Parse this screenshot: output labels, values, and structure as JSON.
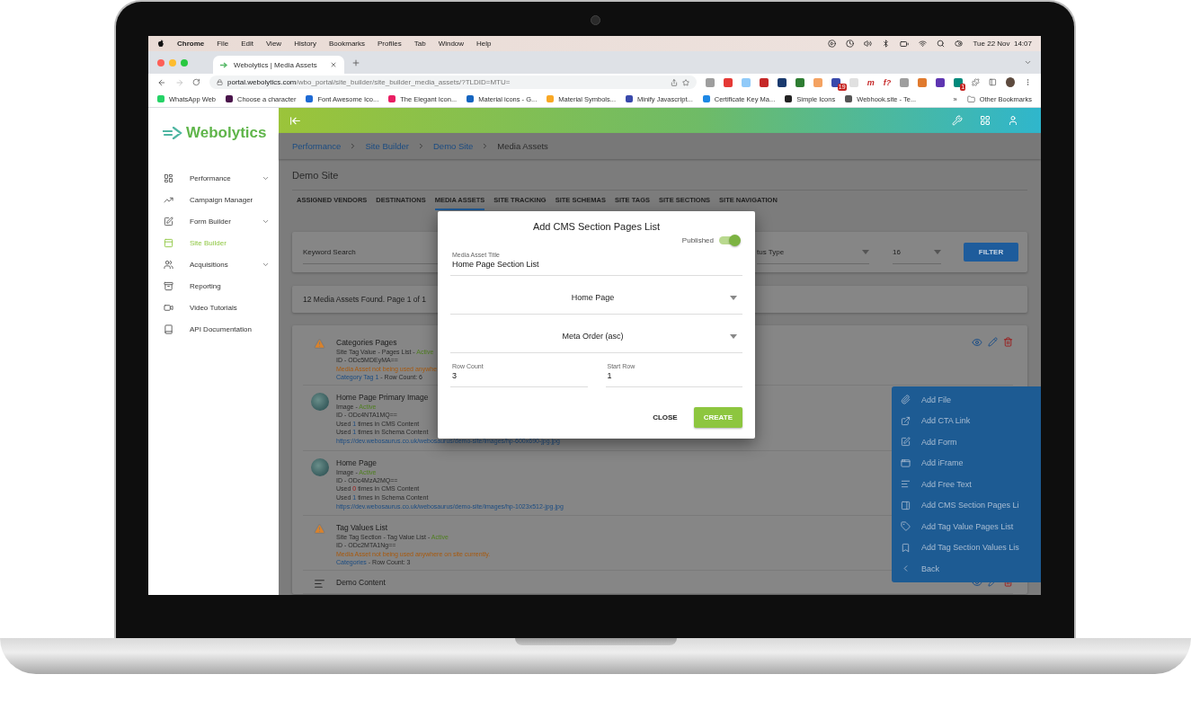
{
  "menubar": {
    "app": "Chrome",
    "menus": [
      "File",
      "Edit",
      "View",
      "History",
      "Bookmarks",
      "Profiles",
      "Tab",
      "Window",
      "Help"
    ],
    "clock": "Tue 22 Nov  14:07"
  },
  "browser": {
    "tab_title": "Webolytics | Media Assets",
    "url_host": "portal.webolytics.com",
    "url_path": "/wbo_portal/site_builder/site_builder_media_assets/?TLDID=MTU=",
    "extension_badges": [
      "19",
      "1"
    ],
    "extension_letters": [
      "m",
      "f?"
    ],
    "bookmarks": [
      "WhatsApp Web",
      "Choose a character",
      "Font Awesome Ico...",
      "The Elegant Icon...",
      "Material icons - G...",
      "Material Symbols...",
      "Minify Javascript...",
      "Certificate Key Ma...",
      "Simple Icons",
      "Webhook.site - Te..."
    ],
    "bookmarks_overflow": "»",
    "other_bookmarks": "Other Bookmarks"
  },
  "sidebar": {
    "brand": "Webolytics",
    "items": [
      {
        "label": "Performance",
        "has_submenu": true,
        "selected": false
      },
      {
        "label": "Campaign Manager",
        "has_submenu": false,
        "selected": false
      },
      {
        "label": "Form Builder",
        "has_submenu": true,
        "selected": false
      },
      {
        "label": "Site Builder",
        "has_submenu": false,
        "selected": true
      },
      {
        "label": "Acquisitions",
        "has_submenu": true,
        "selected": false
      },
      {
        "label": "Reporting",
        "has_submenu": false,
        "selected": false
      },
      {
        "label": "Video Tutorials",
        "has_submenu": false,
        "selected": false
      },
      {
        "label": "API Documentation",
        "has_submenu": false,
        "selected": false
      }
    ]
  },
  "breadcrumb": [
    {
      "label": "Performance",
      "kind": "link"
    },
    {
      "label": "Site Builder",
      "kind": "link"
    },
    {
      "label": "Demo Site",
      "kind": "link"
    },
    {
      "label": "Media Assets",
      "kind": "current"
    }
  ],
  "page_title": "Demo Site",
  "tabs": [
    {
      "label": "ASSIGNED VENDORS",
      "selected": false
    },
    {
      "label": "DESTINATIONS",
      "selected": false
    },
    {
      "label": "MEDIA ASSETS",
      "selected": true
    },
    {
      "label": "SITE TRACKING",
      "selected": false
    },
    {
      "label": "SITE SCHEMAS",
      "selected": false
    },
    {
      "label": "SITE TAGS",
      "selected": false
    },
    {
      "label": "SITE SECTIONS",
      "selected": false
    },
    {
      "label": "SITE NAVIGATION",
      "selected": false
    }
  ],
  "filters": {
    "keyword": {
      "placeholder": "Keyword Search"
    },
    "status": {
      "placeholder": "tus Type"
    },
    "page_size": {
      "value": "16"
    },
    "button": "FILTER"
  },
  "result_count": "12 Media Assets Found. Page 1 of 1",
  "assets": [
    {
      "kind": "warning",
      "title": "Categories Pages",
      "actions": true,
      "lines": [
        [
          {
            "text": "Site Tag Value - Pages List - "
          },
          {
            "text": "Active",
            "kind": "success"
          }
        ],
        [
          {
            "text": "ID - ODc5MDEyMA=="
          }
        ],
        [
          {
            "text": "Media Asset not being used anywhe",
            "kind": "warning"
          }
        ],
        [
          {
            "text": "Category Tag 1",
            "kind": "link"
          },
          {
            "text": " - Row Count: 6"
          }
        ]
      ]
    },
    {
      "kind": "image",
      "title": "Home Page Primary Image",
      "actions": false,
      "lines": [
        [
          {
            "text": "Image - "
          },
          {
            "text": "Active",
            "kind": "success"
          }
        ],
        [
          {
            "text": "ID - ODc4NTA1MQ=="
          }
        ],
        [
          {
            "text": "Used "
          },
          {
            "text": "1",
            "kind": "link"
          },
          {
            "text": " times in CMS Content"
          }
        ],
        [
          {
            "text": "Used "
          },
          {
            "text": "1",
            "kind": "link"
          },
          {
            "text": " times in Schema Content"
          }
        ]
      ],
      "url": "https://dev.webosaurus.co.uk/webosaurus/demo-site/images/hp-600x690-jpg.jpg"
    },
    {
      "kind": "image",
      "title": "Home Page",
      "actions": false,
      "lines": [
        [
          {
            "text": "Image - "
          },
          {
            "text": "Active",
            "kind": "success"
          }
        ],
        [
          {
            "text": "ID - ODc4MzA2MQ=="
          }
        ],
        [
          {
            "text": "Used "
          },
          {
            "text": "0",
            "kind": "danger"
          },
          {
            "text": " times in CMS Content"
          }
        ],
        [
          {
            "text": "Used "
          },
          {
            "text": "1",
            "kind": "link"
          },
          {
            "text": " times in Schema Content"
          }
        ]
      ],
      "url": "https://dev.webosaurus.co.uk/webosaurus/demo-site/images/hp-1023x512-jpg.jpg"
    },
    {
      "kind": "warning",
      "title": "Tag Values List",
      "actions": false,
      "lines": [
        [
          {
            "text": "Site Tag Section - Tag Value List - "
          },
          {
            "text": "Active",
            "kind": "success"
          }
        ],
        [
          {
            "text": "ID - ODc2MTA1Ng=="
          }
        ],
        [
          {
            "text": "Media Asset not being used anywhere on site currently.",
            "kind": "warning"
          }
        ],
        [
          {
            "text": "Categories",
            "kind": "link"
          },
          {
            "text": " - Row Count: 3"
          }
        ]
      ]
    },
    {
      "kind": "text",
      "title": "Demo Content",
      "actions": true
    }
  ],
  "dialog": {
    "title": "Add CMS Section Pages List",
    "published_label": "Published",
    "published": true,
    "title_field": {
      "label": "Media Asset Title",
      "value": "Home Page Section List"
    },
    "page_select": {
      "value": "Home Page"
    },
    "order_select": {
      "value": "Meta Order (asc)"
    },
    "row_count": {
      "label": "Row Count",
      "value": "3"
    },
    "start_row": {
      "label": "Start Row",
      "value": "1"
    },
    "close": "CLOSE",
    "create": "CREATE"
  },
  "add_menu": {
    "items": [
      "Add File",
      "Add CTA Link",
      "Add Form",
      "Add iFrame",
      "Add Free Text",
      "Add CMS Section Pages Li",
      "Add Tag Value Pages List",
      "Add Tag Section Values Lis",
      "Back"
    ]
  }
}
